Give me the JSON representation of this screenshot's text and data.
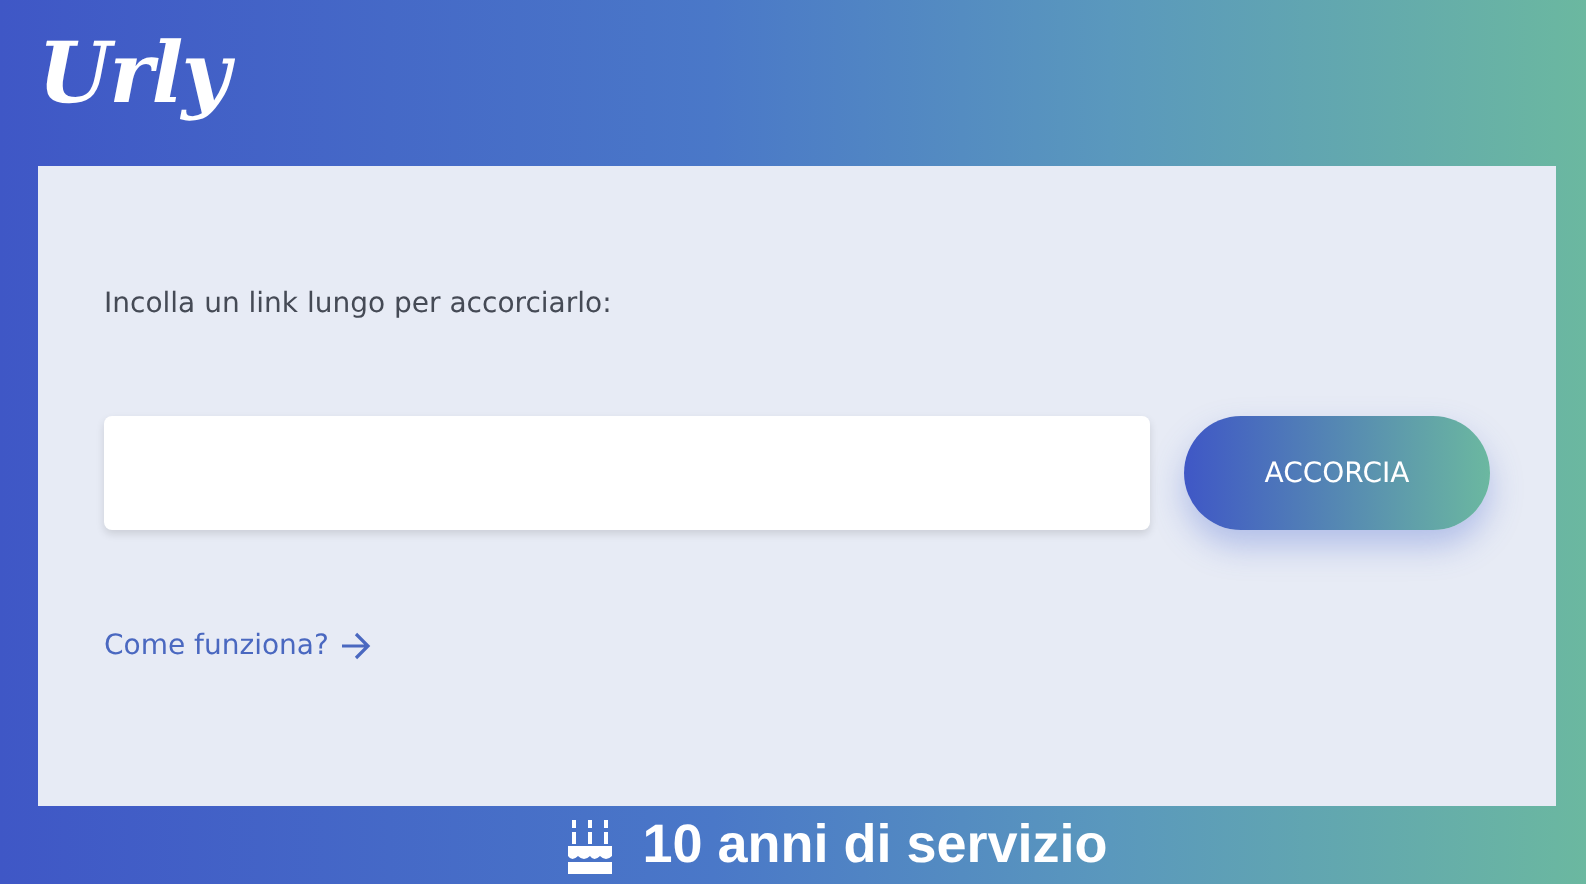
{
  "logo": "Urly",
  "form": {
    "label": "Incolla un link lungo per accorciarlo:",
    "button": "ACCORCIA"
  },
  "help_link": "Come funziona?",
  "banner": "10 anni di servizio"
}
